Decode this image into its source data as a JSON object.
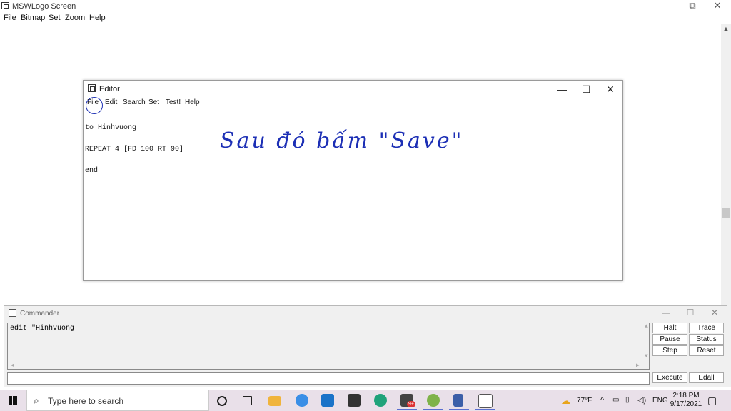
{
  "main_window": {
    "title": "MSWLogo Screen",
    "menu": [
      "File",
      "Bitmap",
      "Set",
      "Zoom",
      "Help"
    ],
    "controls": {
      "minimize": "—",
      "restore": "⧉",
      "close": "✕"
    }
  },
  "editor": {
    "title": "Editor",
    "menu": [
      "File",
      "Edit",
      "Search",
      "Set",
      "Test!",
      "Help"
    ],
    "controls": {
      "minimize": "—",
      "maximize": "☐",
      "close": "✕"
    },
    "code_lines": [
      "to Hinhvuong",
      "REPEAT 4 [FD 100 RT 90]",
      "end"
    ]
  },
  "annotation": {
    "handwritten_note": "Sau đó bấm \"Save\"",
    "color": "#1c2fb5"
  },
  "commander": {
    "title": "Commander",
    "controls": {
      "minimize": "—",
      "maximize": "☐",
      "close": "✕"
    },
    "output_text": "edit \"Hinhvuong",
    "input_value": "",
    "buttons": {
      "halt": "Halt",
      "trace": "Trace",
      "pause": "Pause",
      "status": "Status",
      "step": "Step",
      "reset": "Reset",
      "execute": "Execute",
      "edall": "Edall"
    }
  },
  "taskbar": {
    "search_placeholder": "Type here to search",
    "weather": "77°F",
    "language": "ENG",
    "time": "2:18 PM",
    "date": "9/17/2021",
    "notification_badge": "9+",
    "icons": [
      "start-icon",
      "cortana-icon",
      "task-view-icon",
      "file-explorer-icon",
      "edge-legacy-icon",
      "mail-icon",
      "store-icon",
      "edge-icon",
      "app-icon",
      "chrome-icon",
      "calculator-icon",
      "mswlogo-icon"
    ]
  }
}
